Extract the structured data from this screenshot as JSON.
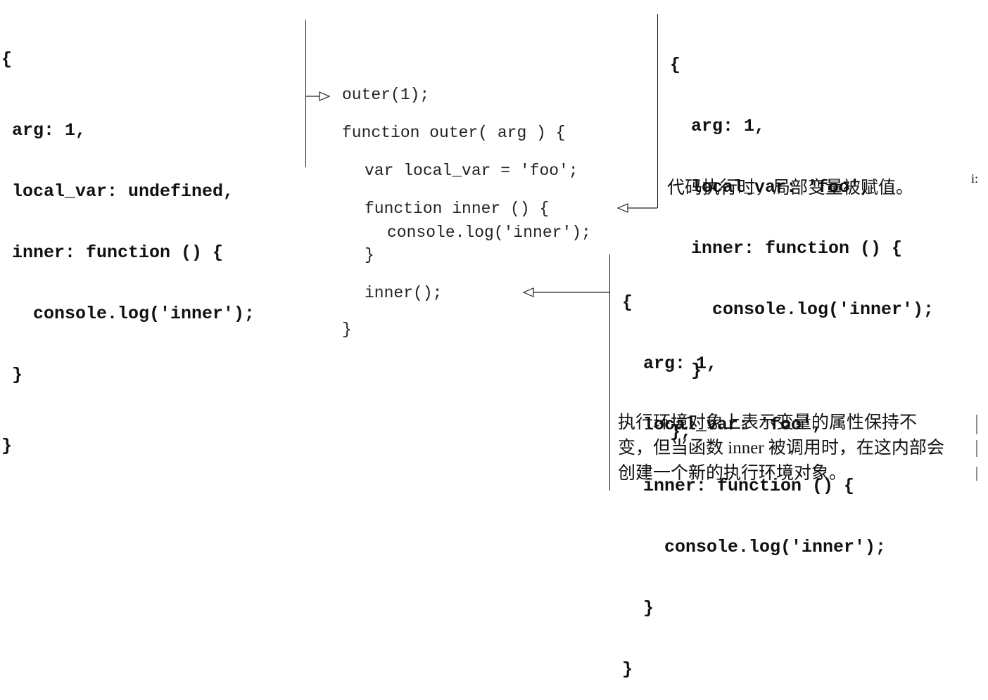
{
  "object_initial": {
    "lines": [
      "{",
      " arg: 1,",
      " local_var: undefined,",
      " inner: function () {",
      "   console.log('inner');",
      " }",
      "}"
    ]
  },
  "object_assigned": {
    "lines": [
      "{",
      "  arg: 1,",
      "  local_var: 'foo',",
      "  inner: function () {",
      "    console.log('inner');",
      "  }",
      "};"
    ],
    "caption_lines": [
      "代码执行时，局部变量被赋值。"
    ],
    "stray_char": "i:"
  },
  "object_inner_call": {
    "lines": [
      "{",
      "  arg: 1,",
      "  local_var: 'foo',",
      "  inner: function () {",
      "    console.log('inner');",
      "  }",
      "}"
    ],
    "caption_lines": [
      "执行环境对象上表示变量的属性保持不",
      "变，但当函数 inner 被调用时，在这内部会",
      "创建一个新的执行环境对象。"
    ]
  },
  "source_code": {
    "call_outer": "outer(1);",
    "function_outer": "function outer( arg ) {",
    "var_local": "var local_var = 'foo';",
    "function_inner": "function inner () {",
    "console_log": "console.log('inner');",
    "close_inner": "}",
    "call_inner": "inner();",
    "close_outer": "}"
  }
}
